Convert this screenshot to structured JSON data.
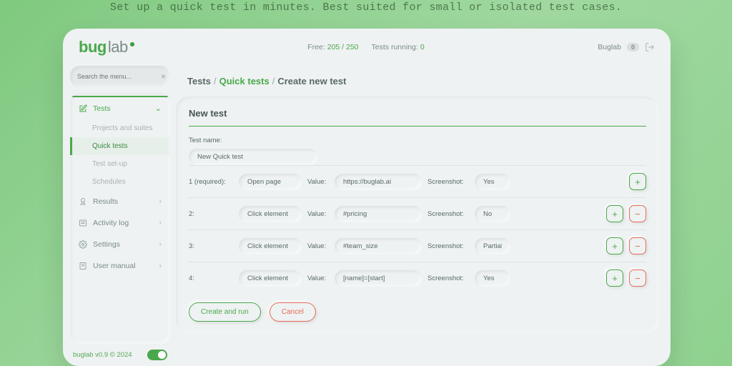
{
  "tagline": "Set up a quick test in minutes. Best suited for small or isolated test cases.",
  "brand": {
    "part1": "bug",
    "part2": "lab"
  },
  "topbar": {
    "free_label": "Free:",
    "free_value": "205 / 250",
    "running_label": "Tests running:",
    "running_value": "0",
    "account_name": "Buglab",
    "badge": "0"
  },
  "sidebar": {
    "search_placeholder": "Search the menu...",
    "items": [
      {
        "label": "Tests",
        "expanded": true
      },
      {
        "label": "Results"
      },
      {
        "label": "Activity log"
      },
      {
        "label": "Settings"
      },
      {
        "label": "User manual"
      }
    ],
    "sub_items": [
      {
        "label": "Projects and suites"
      },
      {
        "label": "Quick tests",
        "active": true
      },
      {
        "label": "Test set-up"
      },
      {
        "label": "Schedules"
      }
    ],
    "footer": "buglab v0.9 © 2024"
  },
  "breadcrumb": {
    "a": "Tests",
    "b": "Quick tests",
    "c": "Create new test"
  },
  "form": {
    "heading": "New test",
    "name_label": "Test name:",
    "name_value": "New Quick test",
    "value_label": "Value:",
    "screenshot_label": "Screenshot:",
    "steps": [
      {
        "num": "1 (required):",
        "action": "Open page",
        "value": "https://buglab.ai",
        "screenshot": "Yes",
        "can_remove": false
      },
      {
        "num": "2:",
        "action": "Click element",
        "value": "#pricing",
        "screenshot": "No",
        "can_remove": true
      },
      {
        "num": "3:",
        "action": "Click element",
        "value": "#team_size",
        "screenshot": "Partial",
        "can_remove": true
      },
      {
        "num": "4:",
        "action": "Click element",
        "value": "[name]=[start]",
        "screenshot": "Yes",
        "can_remove": true
      }
    ],
    "run_label": "Create and run",
    "cancel_label": "Cancel"
  }
}
